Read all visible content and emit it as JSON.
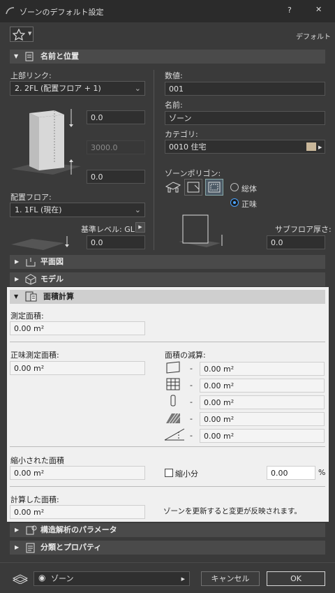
{
  "window": {
    "title": "ゾーンのデフォルト設定",
    "help": "?",
    "close": "✕"
  },
  "header": {
    "default_label": "デフォルト"
  },
  "sections": {
    "name_position": "名前と位置",
    "plan": "平面図",
    "model": "モデル",
    "area_calc": "面積計算",
    "structural": "構造解析のパラメータ",
    "classification": "分類とプロパティ"
  },
  "left": {
    "top_link_label": "上部リンク:",
    "top_link_value": "2. 2FL (配置フロア + 1)",
    "offset_top": "0.0",
    "height": "3000.0",
    "offset_bottom": "0.0",
    "home_floor_label": "配置フロア:",
    "home_floor_value": "1. 1FL (現在)",
    "ref_level_label": "基準レベル: GL",
    "ref_level_value": "0.0"
  },
  "right": {
    "number_label": "数値:",
    "number_value": "001",
    "name_label": "名前:",
    "name_value": "ゾーン",
    "category_label": "カテゴリ:",
    "category_value": "0010  住宅",
    "polygon_label": "ゾーンポリゴン:",
    "radio_gross": "総体",
    "radio_net": "正味",
    "subfloor_label": "サブフロア厚さ:",
    "subfloor_value": "0.0"
  },
  "area": {
    "measured_label": "測定面積:",
    "measured_value": "0.00 m²",
    "net_label": "正味測定面積:",
    "net_value": "0.00 m²",
    "deduct_label": "面積の減算:",
    "deductions": [
      {
        "icon": "wall-deduct-icon",
        "value": "0.00 m²"
      },
      {
        "icon": "grid-deduct-icon",
        "value": "0.00 m²"
      },
      {
        "icon": "column-deduct-icon",
        "value": "0.00 m²"
      },
      {
        "icon": "fill-deduct-icon",
        "value": "0.00 m²"
      },
      {
        "icon": "slope-deduct-icon",
        "value": "0.00 m²"
      }
    ],
    "dash": "-",
    "reduced_label": "縮小された面積",
    "reduced_value": "0.00 m²",
    "reduce_check": "縮小分",
    "reduce_pct": "0.00",
    "pct": "%",
    "calc_label": "計算した面積:",
    "calc_value": "0.00 m²",
    "note": "ゾーンを更新すると変更が反映されます。"
  },
  "footer": {
    "layer": "ゾーン",
    "cancel": "キャンセル",
    "ok": "OK"
  },
  "colors": {
    "highlight": "#f0f0f0",
    "ok_accent": "#d8d8d8"
  }
}
